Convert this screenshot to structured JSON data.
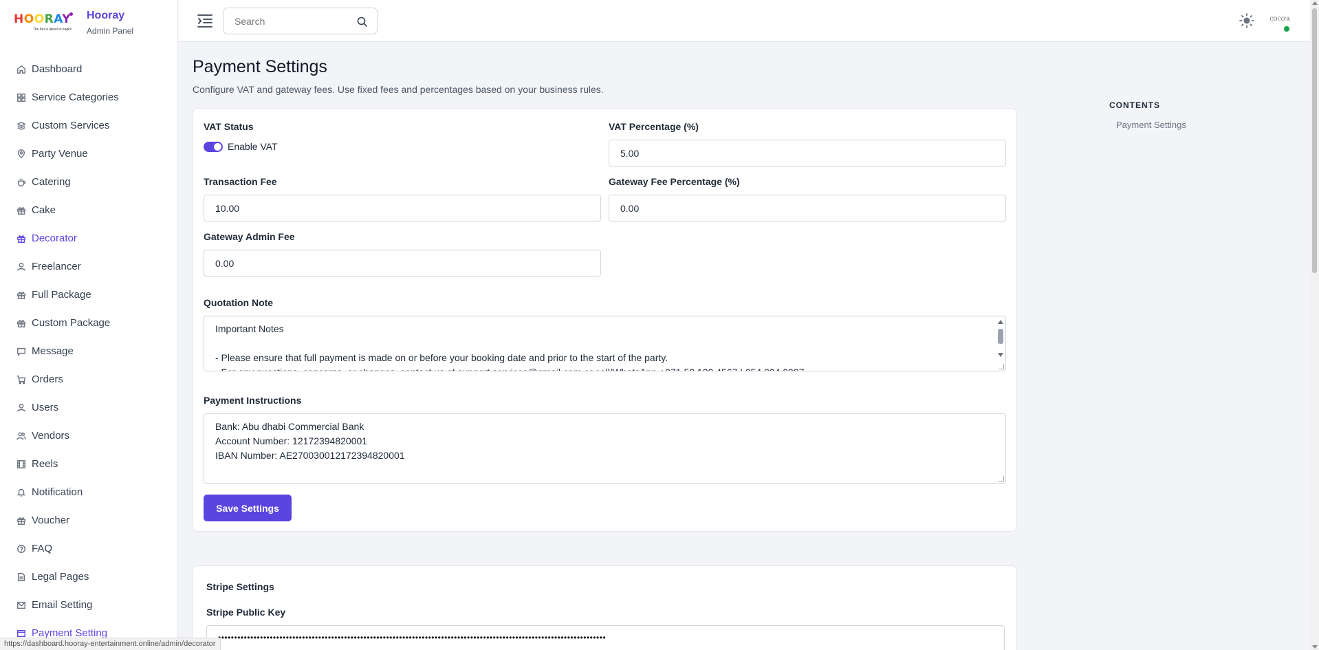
{
  "brand": {
    "logo_text": "HOORAY",
    "logo_tagline": "The fun is about to begin!",
    "title": "Hooray",
    "subtitle": "Admin Panel"
  },
  "sidebar": {
    "items": [
      {
        "label": "Dashboard",
        "icon": "home-icon"
      },
      {
        "label": "Service Categories",
        "icon": "grid-icon"
      },
      {
        "label": "Custom Services",
        "icon": "layers-icon"
      },
      {
        "label": "Party Venue",
        "icon": "map-pin-icon"
      },
      {
        "label": "Catering",
        "icon": "cup-icon"
      },
      {
        "label": "Cake",
        "icon": "gift-icon"
      },
      {
        "label": "Decorator",
        "icon": "gift-icon"
      },
      {
        "label": "Freelancer",
        "icon": "user-icon"
      },
      {
        "label": "Full Package",
        "icon": "gift-icon"
      },
      {
        "label": "Custom Package",
        "icon": "gift-icon"
      },
      {
        "label": "Message",
        "icon": "chat-icon"
      },
      {
        "label": "Orders",
        "icon": "cart-icon"
      },
      {
        "label": "Users",
        "icon": "user-icon"
      },
      {
        "label": "Vendors",
        "icon": "users-icon"
      },
      {
        "label": "Reels",
        "icon": "film-icon"
      },
      {
        "label": "Notification",
        "icon": "bell-icon"
      },
      {
        "label": "Voucher",
        "icon": "gift-icon"
      },
      {
        "label": "FAQ",
        "icon": "question-icon"
      },
      {
        "label": "Legal Pages",
        "icon": "file-icon"
      },
      {
        "label": "Email Setting",
        "icon": "mail-icon"
      },
      {
        "label": "Payment Setting",
        "icon": "card-icon"
      }
    ],
    "active_colors": {
      "accent": "#5b45e0"
    }
  },
  "status_url": "https://dashboard.hooray-entertainment.online/admin/decorator",
  "topbar": {
    "search_placeholder": "Search",
    "avatar_text": "COCO'A"
  },
  "page": {
    "title": "Payment Settings",
    "description": "Configure VAT and gateway fees. Use fixed fees and percentages based on your business rules."
  },
  "toc": {
    "heading": "CONTENTS",
    "links": [
      "Payment Settings"
    ]
  },
  "form": {
    "vat_status_label": "VAT Status",
    "vat_toggle_label": "Enable VAT",
    "vat_enabled": true,
    "vat_percentage_label": "VAT Percentage (%)",
    "vat_percentage_value": "5.00",
    "transaction_fee_label": "Transaction Fee",
    "transaction_fee_value": "10.00",
    "gateway_fee_pct_label": "Gateway Fee Percentage (%)",
    "gateway_fee_pct_value": "0.00",
    "gateway_admin_fee_label": "Gateway Admin Fee",
    "gateway_admin_fee_value": "0.00",
    "quotation_note_label": "Quotation Note",
    "quotation_note_lines": [
      "Important Notes",
      "",
      "- Please ensure that full payment is made on or before your booking date and prior to the start of the party.",
      "- For any questions, concerns, or changes, contact us at support.services@gmail.com or call/WhatsApp +971 52 123 4567 | 054 804 0987"
    ],
    "payment_instructions_label": "Payment Instructions",
    "payment_instructions_lines": [
      "Bank: Abu dhabi Commercial Bank",
      "Account Number: 12172394820001",
      "IBAN Number: AE270030012172394820001"
    ],
    "save_label": "Save Settings"
  },
  "stripe": {
    "section_title": "Stripe Settings",
    "public_key_label": "Stripe Public Key",
    "public_key_masked": "••••••••••••••••••••••••••••••••••••••••••••••••••••••••••••••••••••••••••••••••••••••••••••••••••••••••••••••••••••••••"
  }
}
